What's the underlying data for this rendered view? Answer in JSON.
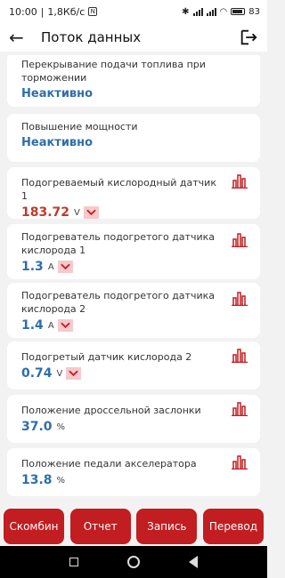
{
  "status_bar": {
    "time": "10:00",
    "speed": "1,8Кб/с",
    "battery": "83"
  },
  "app_bar": {
    "title": "Поток данных"
  },
  "items": [
    {
      "label": "Перекрывание подачи топлива при торможении",
      "value": "Неактивно"
    },
    {
      "label": "Повышение мощности",
      "value": "Неактивно"
    },
    {
      "label": "Подогреваемый кислородный датчик 1",
      "value": "183.72",
      "unit": "V"
    },
    {
      "label": "Подогреватель подогретого датчика кислорода 1",
      "value": "1.3",
      "unit": "A"
    },
    {
      "label": "Подогреватель подогретого датчика кислорода 2",
      "value": "1.4",
      "unit": "A"
    },
    {
      "label": "Подогретый датчик кислорода 2",
      "value": "0.74",
      "unit": "V"
    },
    {
      "label": "Положение дроссельной заслонки",
      "value": "37.0",
      "unit": "%"
    },
    {
      "label": "Положение педали акселератора",
      "value": "13.8",
      "unit": "%"
    }
  ],
  "buttons": {
    "combine": "Скомбин",
    "report": "Отчет",
    "record": "Запись",
    "translate": "Перевод"
  },
  "colors": {
    "accent_red": "#c21d21",
    "value_blue": "#2f6ea8",
    "value_red": "#c0392b"
  },
  "icons": {
    "graph": "bar-graph-icon",
    "dropdown": "chevron-down-icon",
    "back": "back-arrow-icon",
    "exit": "exit-icon"
  }
}
